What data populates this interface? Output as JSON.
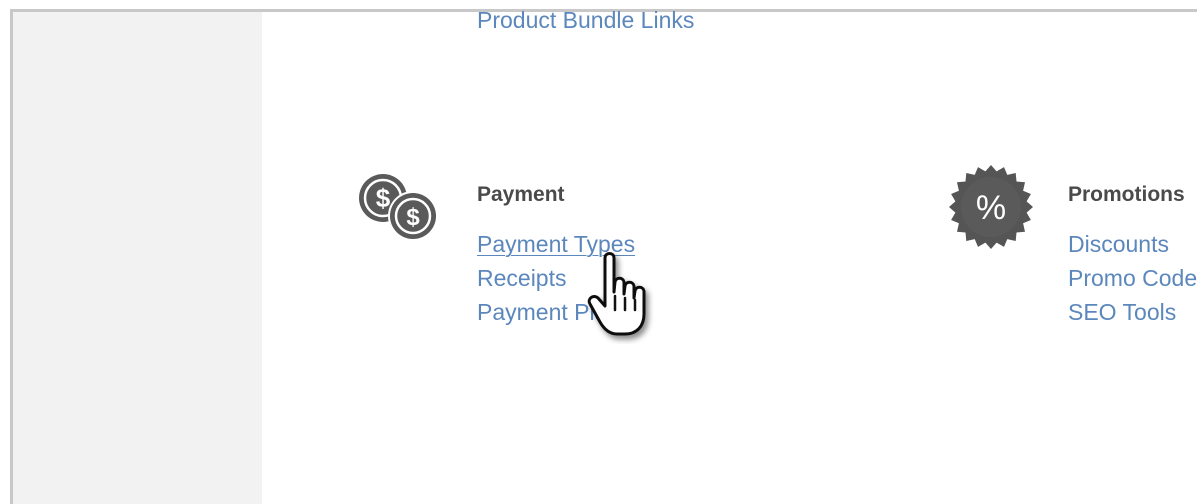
{
  "top_link": "Product Bundle Links",
  "payment": {
    "heading": "Payment",
    "icon": "coins-icon",
    "links": [
      "Payment Types",
      "Receipts",
      "Payment Plans"
    ]
  },
  "promotions": {
    "heading": "Promotions",
    "icon": "percent-badge-icon",
    "links": [
      "Discounts",
      "Promo Codes",
      "SEO Tools"
    ]
  },
  "cursor": "hand-pointer-cursor",
  "colors": {
    "link": "#5b87bd",
    "heading": "#4a4a4a",
    "icon": "#5a5a5a",
    "sidebar": "#f2f2f2"
  }
}
